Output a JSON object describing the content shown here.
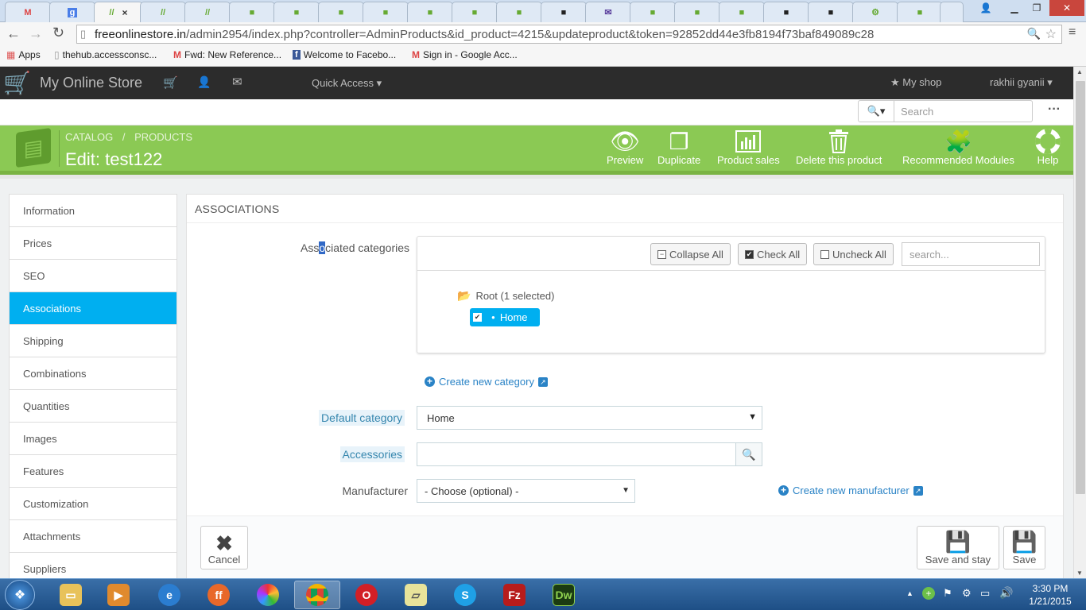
{
  "browser": {
    "url_host": "freeonlinestore.in",
    "url_path": "/admin2954/index.php?controller=AdminProducts&id_product=4215&updateproduct&token=92852dd44e3fb8194f73baf849089c28",
    "tab_close": "×",
    "bookmarks": [
      {
        "label": "Apps"
      },
      {
        "label": "thehub.accessconsc..."
      },
      {
        "label": "Fwd: New Reference..."
      },
      {
        "label": "Welcome to Facebo..."
      },
      {
        "label": "Sign in - Google Acc..."
      }
    ]
  },
  "header": {
    "store_name": "My Online Store",
    "quick_access": "Quick Access",
    "my_shop": "My shop",
    "user": "rakhii gyanii",
    "search_placeholder": "Search",
    "more": "···"
  },
  "toolbar": {
    "breadcrumb_catalog": "CATALOG",
    "breadcrumb_sep": "/",
    "breadcrumb_products": "PRODUCTS",
    "page_title": "Edit: test122",
    "buttons": {
      "preview": "Preview",
      "duplicate": "Duplicate",
      "sales": "Product sales",
      "delete": "Delete this product",
      "modules": "Recommended Modules",
      "help": "Help"
    }
  },
  "sidebar": {
    "items": [
      {
        "label": "Information"
      },
      {
        "label": "Prices"
      },
      {
        "label": "SEO"
      },
      {
        "label": "Associations"
      },
      {
        "label": "Shipping"
      },
      {
        "label": "Combinations"
      },
      {
        "label": "Quantities"
      },
      {
        "label": "Images"
      },
      {
        "label": "Features"
      },
      {
        "label": "Customization"
      },
      {
        "label": "Attachments"
      },
      {
        "label": "Suppliers"
      }
    ]
  },
  "associations": {
    "heading": "ASSOCIATIONS",
    "categories_label_a": "Ass",
    "categories_label_b": "o",
    "categories_label_c": "ciated categories",
    "collapse_all": "Collapse All",
    "check_all": "Check All",
    "uncheck_all": "Uncheck All",
    "tree_search_placeholder": "search...",
    "root_label": "Root (1 selected)",
    "home_label": "Home",
    "create_category": "Create new category",
    "default_category_label": "Default category",
    "default_category_value": "Home",
    "accessories_label": "Accessories",
    "manufacturer_label": "Manufacturer",
    "manufacturer_value": "- Choose (optional) -",
    "create_manufacturer": "Create new manufacturer"
  },
  "footer": {
    "cancel": "Cancel",
    "save_and_stay": "Save and stay",
    "save": "Save"
  },
  "clock": {
    "time": "3:30 PM",
    "date": "1/21/2015"
  },
  "colors": {
    "toolbar_green": "#8bc954",
    "active_blue": "#00aff0",
    "admin_header": "#2c2c2c"
  }
}
